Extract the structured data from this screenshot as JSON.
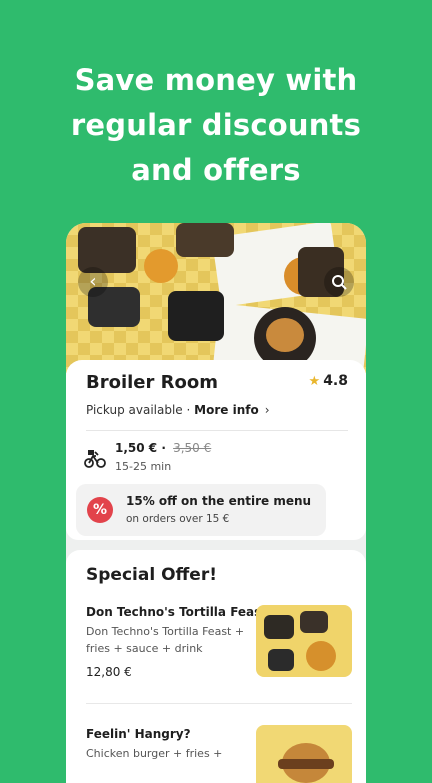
{
  "headline": {
    "line1": "Save money with",
    "line2": "regular discounts",
    "line3": "and offers"
  },
  "hero": {
    "back_icon": "arrow-left-icon",
    "search_icon": "search-icon"
  },
  "restaurant": {
    "name": "Broiler Room",
    "rating": "4.8",
    "pickup_text": "Pickup available ·",
    "more_info": "More info",
    "more_info_chevron": "›",
    "fee_price": "1,50 €",
    "fee_separator": "·",
    "fee_old_price": "3,50 €",
    "delivery_time": "15-25 min",
    "discount_title": "15% off on the entire menu",
    "discount_subtitle": "on orders over 15 €",
    "discount_badge": "%"
  },
  "special_offer": {
    "title": "Special Offer!",
    "items": [
      {
        "name": "Don Techno's Tortilla Feast",
        "description": "Don Techno's Tortilla Feast + fries + sauce + drink",
        "price": "12,80 €"
      },
      {
        "name": "Feelin' Hangry?",
        "description": "Chicken burger + fries +",
        "price": ""
      }
    ]
  },
  "colors": {
    "background": "#2fbb6d",
    "rating_star": "#e9b62d",
    "discount_badge": "#e2434b"
  }
}
